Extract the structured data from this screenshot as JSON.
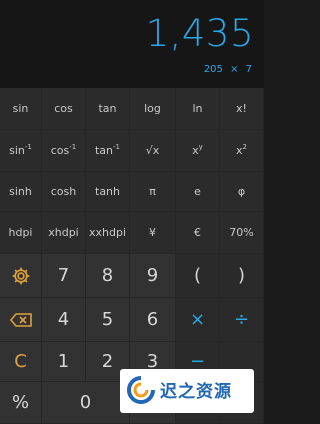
{
  "display": {
    "result": "1,435",
    "expression": "205 × 7"
  },
  "sci_rows": [
    [
      {
        "label": "sin"
      },
      {
        "label": "cos"
      },
      {
        "label": "tan"
      },
      {
        "label": "log"
      },
      {
        "label": "ln"
      },
      {
        "label": "x!"
      }
    ],
    [
      {
        "label": "sin",
        "sup": "-1"
      },
      {
        "label": "cos",
        "sup": "-1"
      },
      {
        "label": "tan",
        "sup": "-1"
      },
      {
        "label": "√x"
      },
      {
        "label": "x",
        "sup": "y"
      },
      {
        "label": "x",
        "sup": "2"
      }
    ],
    [
      {
        "label": "sinh"
      },
      {
        "label": "cosh"
      },
      {
        "label": "tanh"
      },
      {
        "label": "π"
      },
      {
        "label": "e"
      },
      {
        "label": "φ"
      }
    ],
    [
      {
        "label": "hdpi"
      },
      {
        "label": "xhdpi"
      },
      {
        "label": "xxhdpi"
      },
      {
        "label": "¥"
      },
      {
        "label": "€"
      },
      {
        "label": "70%"
      }
    ]
  ],
  "pad": {
    "digits": {
      "7": "7",
      "8": "8",
      "9": "9",
      "4": "4",
      "5": "5",
      "6": "6",
      "1": "1",
      "2": "2",
      "3": "3",
      "0": "0"
    },
    "open_paren": "(",
    "close_paren": ")",
    "multiply": "×",
    "divide": "÷",
    "minus": "−",
    "clear": "C",
    "percent": "%"
  },
  "icons": {
    "settings": "gear-icon",
    "backspace": "backspace-icon"
  },
  "colors": {
    "accent_blue": "#2aa7e6",
    "accent_orange": "#e0a13a"
  },
  "watermark": {
    "text": "迟之资源"
  }
}
